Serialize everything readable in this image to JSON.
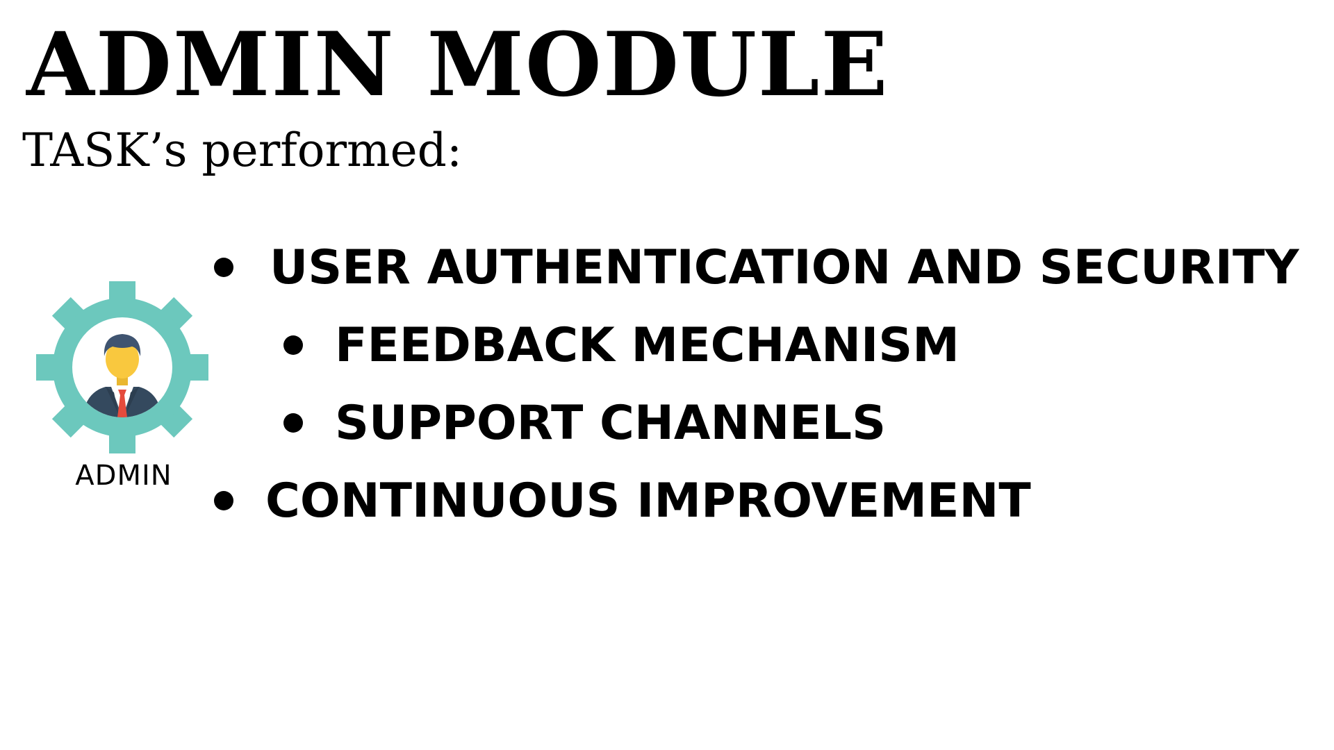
{
  "slide": {
    "title": "ADMIN MODULE",
    "subtitle": "TASK’s performed:"
  },
  "admin_graphic": {
    "icon": "admin-gear-person-icon",
    "label": "ADMIN",
    "colors": {
      "gear": "#6cc8bd",
      "hair": "#3f5470",
      "face": "#f9c83e",
      "suit": "#34495e",
      "shirt": "#ffffff",
      "tie": "#e54b3c"
    }
  },
  "tasks": [
    {
      "label": "USER AUTHENTICATION AND SECURITY",
      "level": 1
    },
    {
      "label": "FEEDBACK MECHANISM",
      "level": 2
    },
    {
      "label": "SUPPORT CHANNELS",
      "level": 2
    },
    {
      "label": "CONTINUOUS IMPROVEMENT",
      "level": 1
    }
  ]
}
